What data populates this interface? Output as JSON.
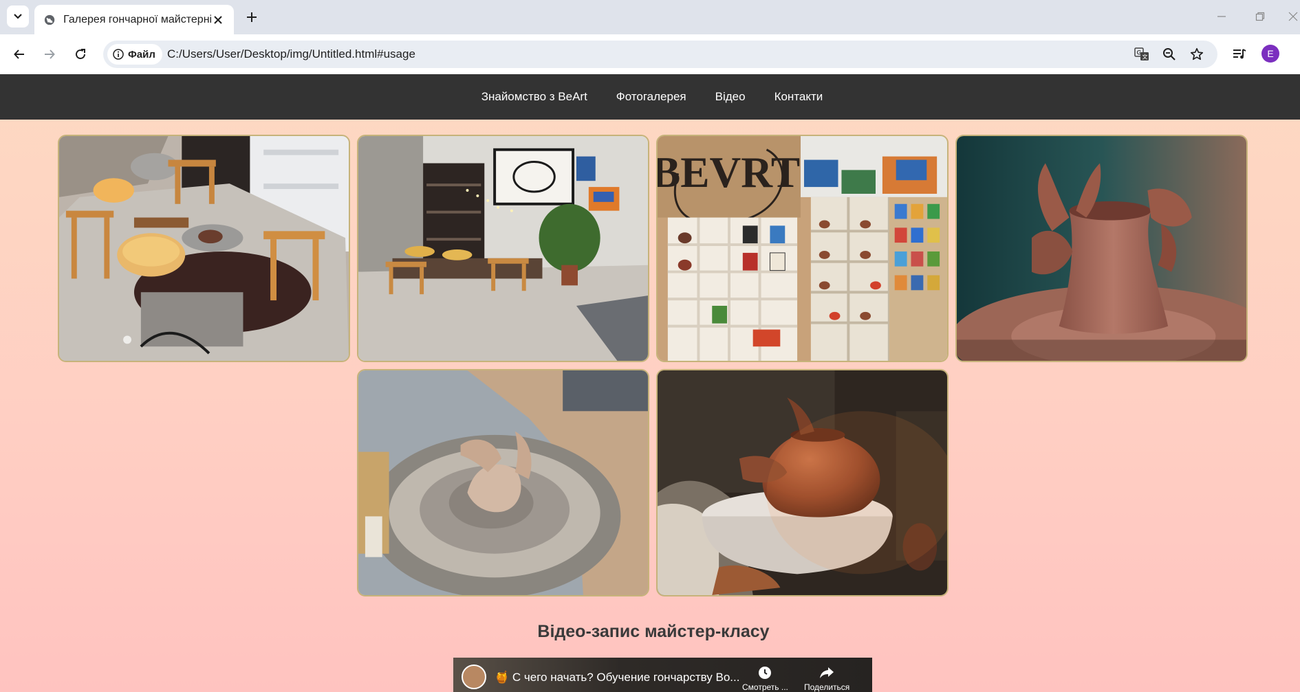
{
  "browser": {
    "tab": {
      "title": "Галерея гончарної майстерні"
    },
    "address": {
      "security_label": "Файл",
      "url": "C:/Users/User/Desktop/img/Untitled.html#usage"
    },
    "profile_initial": "E"
  },
  "site": {
    "nav": [
      "Знайомство з BeArt",
      "Фотогалерея",
      "Відео",
      "Контакти"
    ],
    "gallery": [
      {
        "name": "workshop-wheels-photo",
        "sign_text": ""
      },
      {
        "name": "studio-interior-photo",
        "sign_text": ""
      },
      {
        "name": "shop-shelves-photo",
        "sign_text": "BEVRT"
      },
      {
        "name": "hands-shaping-vase-photo",
        "sign_text": ""
      },
      {
        "name": "centering-clay-photo",
        "sign_text": ""
      },
      {
        "name": "pot-on-wheel-photo",
        "sign_text": ""
      }
    ],
    "video_section": {
      "heading": "Відео-запис майстер-класу",
      "video_title": "🍯 С чего начать? Обучение гончарству Во...",
      "watch_later_label": "Смотреть ...",
      "share_label": "Поделиться"
    }
  },
  "colors": {
    "navbar": "#333333",
    "photo_border": "#c6b37a",
    "page_gradient_top": "#fdd9c2",
    "page_gradient_bottom": "#ffc3c0"
  }
}
